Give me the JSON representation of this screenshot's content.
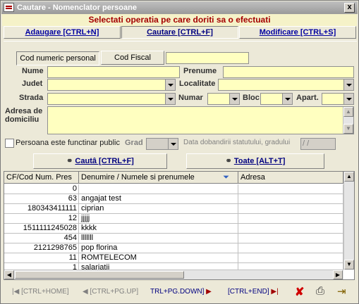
{
  "window": {
    "title": "Cautare - Nomenclator persoane",
    "close_label": "x"
  },
  "banner": "Selectati operatia pe care doriti sa o efectuati",
  "tabs": [
    {
      "label": "Adaugare [CTRL+N]"
    },
    {
      "label": "Cautare [CTRL+F]"
    },
    {
      "label": "Modificare [CTRL+S]"
    }
  ],
  "form": {
    "cnp_button": "Cod numeric personal",
    "cf_button": "Cod Fiscal",
    "nume_label": "Nume",
    "prenume_label": "Prenume",
    "judet_label": "Judet",
    "localitate_label": "Localitate",
    "strada_label": "Strada",
    "numar_label": "Numar",
    "bloc_label": "Bloc",
    "apart_label": "Apart.",
    "adresa_label_1": "Adresa de",
    "adresa_label_2": "domiciliu",
    "functionar_label": "Persoana este functinar public",
    "grad_label": "Grad",
    "data_label": "Data dobandirii statutului, gradului",
    "data_value": " / /",
    "cauta_button": "Cautâ [CTRL+F]",
    "toate_button": "Toate [ALT+T]"
  },
  "grid": {
    "headers": [
      "CF/Cod Num. Pres",
      "Denumire / Numele si prenumele",
      "Adresa"
    ],
    "rows": [
      {
        "cod": "0",
        "denumire": "",
        "adresa": ""
      },
      {
        "cod": "63",
        "denumire": "angajat test",
        "adresa": ""
      },
      {
        "cod": "180343411111",
        "denumire": "ciprian",
        "adresa": ""
      },
      {
        "cod": "12",
        "denumire": "jjjjj",
        "adresa": ""
      },
      {
        "cod": "1511111245028",
        "denumire": "kkkk",
        "adresa": ""
      },
      {
        "cod": "454",
        "denumire": "lllllll",
        "adresa": ""
      },
      {
        "cod": "2121298765",
        "denumire": "pop florina",
        "adresa": ""
      },
      {
        "cod": "11",
        "denumire": "ROMTELECOM",
        "adresa": ""
      },
      {
        "cod": "1",
        "denumire": "salariatii",
        "adresa": ""
      }
    ]
  },
  "nav": {
    "first": "[CTRL+HOME]",
    "prev": "[CTRL+PG.UP]",
    "next": "TRL+PG.DOWN]",
    "last": "[CTRL+END]"
  }
}
